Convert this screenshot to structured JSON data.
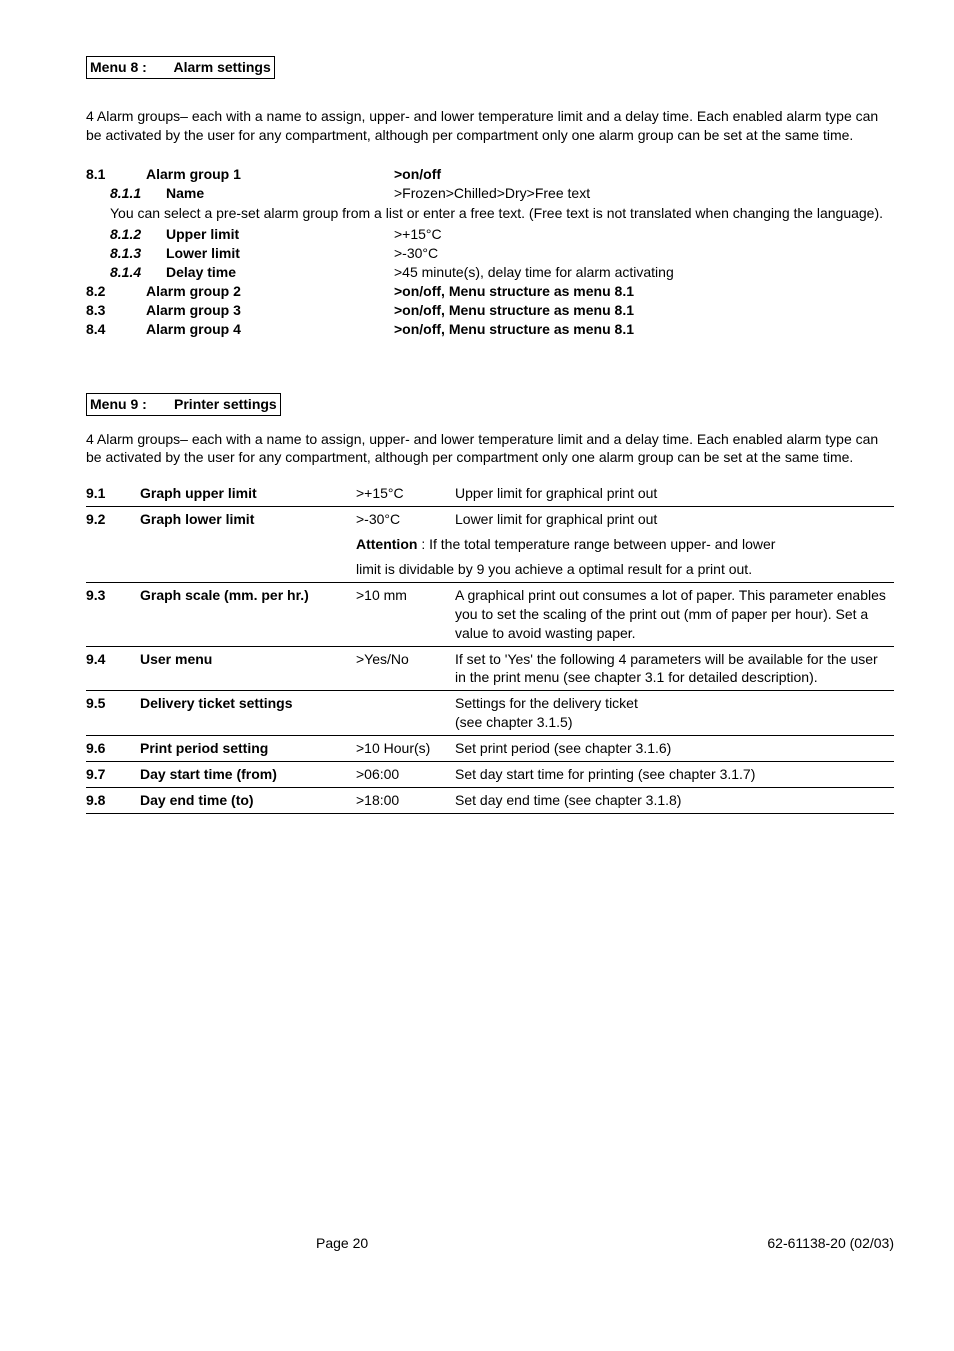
{
  "menu8": {
    "header_label": "Menu 8 :",
    "header_title": "Alarm settings",
    "intro": "4 Alarm groups– each with a name to assign,  upper- and lower temperature limit and a delay time. Each enabled alarm type can be activated by the user for any compartment, although per compartment only one alarm group can be set at the same time.",
    "r1": {
      "num": "8.1",
      "label": "Alarm group 1",
      "val": ">on/off"
    },
    "r1a": {
      "num": "8.1.1",
      "label": "Name",
      "val": ">Frozen>Chilled>Dry>Free text"
    },
    "note": "You can select a pre-set alarm group from a list or enter a free text. (Free text is not translated when changing the language).",
    "r1b": {
      "num": "8.1.2",
      "label": "Upper limit",
      "val": ">+15°C"
    },
    "r1c": {
      "num": "8.1.3",
      "label": "Lower limit",
      "val": ">-30°C"
    },
    "r1d": {
      "num": "8.1.4",
      "label": "Delay time",
      "val": ">45 minute(s), delay time for alarm activating"
    },
    "r2": {
      "num": "8.2",
      "label": "Alarm group 2",
      "val": ">on/off, Menu structure as menu 8.1"
    },
    "r3": {
      "num": "8.3",
      "label": "Alarm group 3",
      "val": ">on/off, Menu structure as menu 8.1"
    },
    "r4": {
      "num": "8.4",
      "label": "Alarm group 4",
      "val": ">on/off, Menu structure as menu 8.1"
    }
  },
  "menu9": {
    "header_label": "Menu 9 :",
    "header_title": "Printer settings",
    "intro": "4 Alarm groups– each with a name to assign,  upper- and lower temperature limit and a delay time. Each enabled alarm type can be activated by the user for any compartment, although per compartment only one alarm group can be set at the same time.",
    "rows": {
      "r1": {
        "num": "9.1",
        "name": "Graph upper limit",
        "val": ">+15°C",
        "desc": "Upper limit for graphical print out"
      },
      "r2": {
        "num": "9.2",
        "name": "Graph lower limit",
        "val": ">-30°C",
        "desc": "Lower limit for graphical print out"
      },
      "r2a_label": "Attention",
      "r2a_rest": " : If the total temperature range between upper- and lower",
      "r2b": "limit is dividable by 9 you achieve a optimal result for a print out.",
      "r3": {
        "num": "9.3",
        "name": "Graph scale (mm. per hr.)",
        "val": ">10 mm",
        "desc": "A graphical print out consumes a lot of paper. This parameter enables you to set the scaling of the print out (mm of paper per hour). Set a value to avoid wasting paper."
      },
      "r4": {
        "num": "9.4",
        "name": "User menu",
        "val": ">Yes/No",
        "desc": "If set to 'Yes' the following 4 parameters will be available for the user in the print menu (see chapter 3.1 for detailed description)."
      },
      "r5": {
        "num": "9.5",
        "name": "Delivery ticket settings",
        "val": "",
        "desc": "Settings for the delivery ticket\n(see chapter 3.1.5)"
      },
      "r6": {
        "num": "9.6",
        "name": "Print period setting",
        "val": ">10 Hour(s)",
        "desc": "Set print period (see chapter 3.1.6)"
      },
      "r7": {
        "num": "9.7",
        "name": "Day start time (from)",
        "val": ">06:00",
        "desc": "Set day start time for printing (see chapter 3.1.7)"
      },
      "r8": {
        "num": "9.8",
        "name": "Day end time (to)",
        "val": ">18:00",
        "desc": "Set day end time (see chapter 3.1.8)"
      }
    }
  },
  "footer": {
    "page": "Page  20",
    "code": "62-61138-20   (02/03)"
  }
}
